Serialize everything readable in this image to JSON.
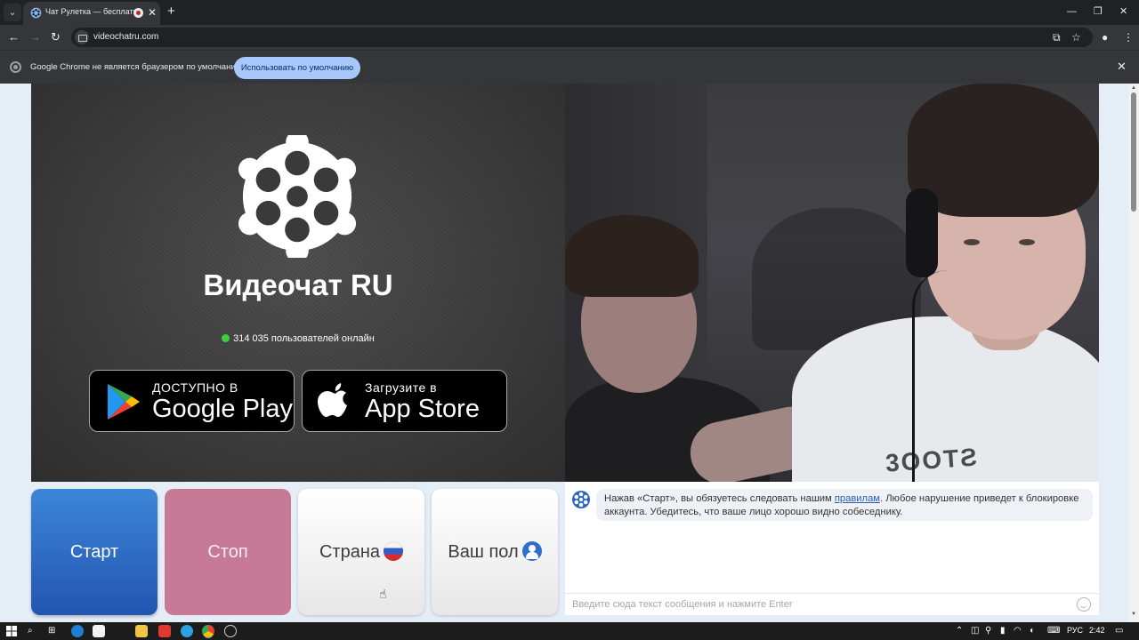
{
  "browser": {
    "tab_title": "Чат Рулетка — бесплатный видеочат",
    "tab_close": "✕",
    "new_tab": "+",
    "url": "videochatru.com",
    "infobar_text": "Google Chrome не является браузером по умолчанию.",
    "infobar_button": "Использовать по умолчанию",
    "infobar_close": "✕",
    "icons": [
      "tab-search-icon",
      "back-icon",
      "forward-icon",
      "reload-icon",
      "install-app-icon",
      "bookmark-star-icon",
      "profile-icon",
      "menu-icon",
      "minimize-icon",
      "restore-icon",
      "close-icon"
    ]
  },
  "hero": {
    "brand": "Видеочат RU",
    "online_text": "314 035 пользователей онлайн",
    "google_play_small": "ДОСТУПНО В",
    "google_play_big": "Google Play",
    "app_store_small": "Загрузите в",
    "app_store_big": "App Store"
  },
  "controls": {
    "start": "Старт",
    "stop": "Стоп",
    "country": "Страна",
    "gender": "Ваш пол"
  },
  "chat": {
    "notice_before": "Нажав «Старт», вы обязуетесь следовать нашим ",
    "notice_link": "правилам",
    "notice_after": ". Любое нарушение приведет к блокировке аккаунта. Убедитесь, что ваше лицо хорошо видно собеседнику.",
    "input_placeholder": "Введите сюда текст сообщения и нажмите Enter"
  },
  "remote_video": {
    "shirt_print": "3OOTƧ"
  },
  "taskbar": {
    "lang": "РУС",
    "time": "2:42"
  },
  "colors": {
    "start": "#2a64c0",
    "stop": "#c77a96",
    "page_bg": "#e5eef7",
    "online_dot": "#3ecf3a",
    "infobar_button": "#a8c7fa"
  }
}
